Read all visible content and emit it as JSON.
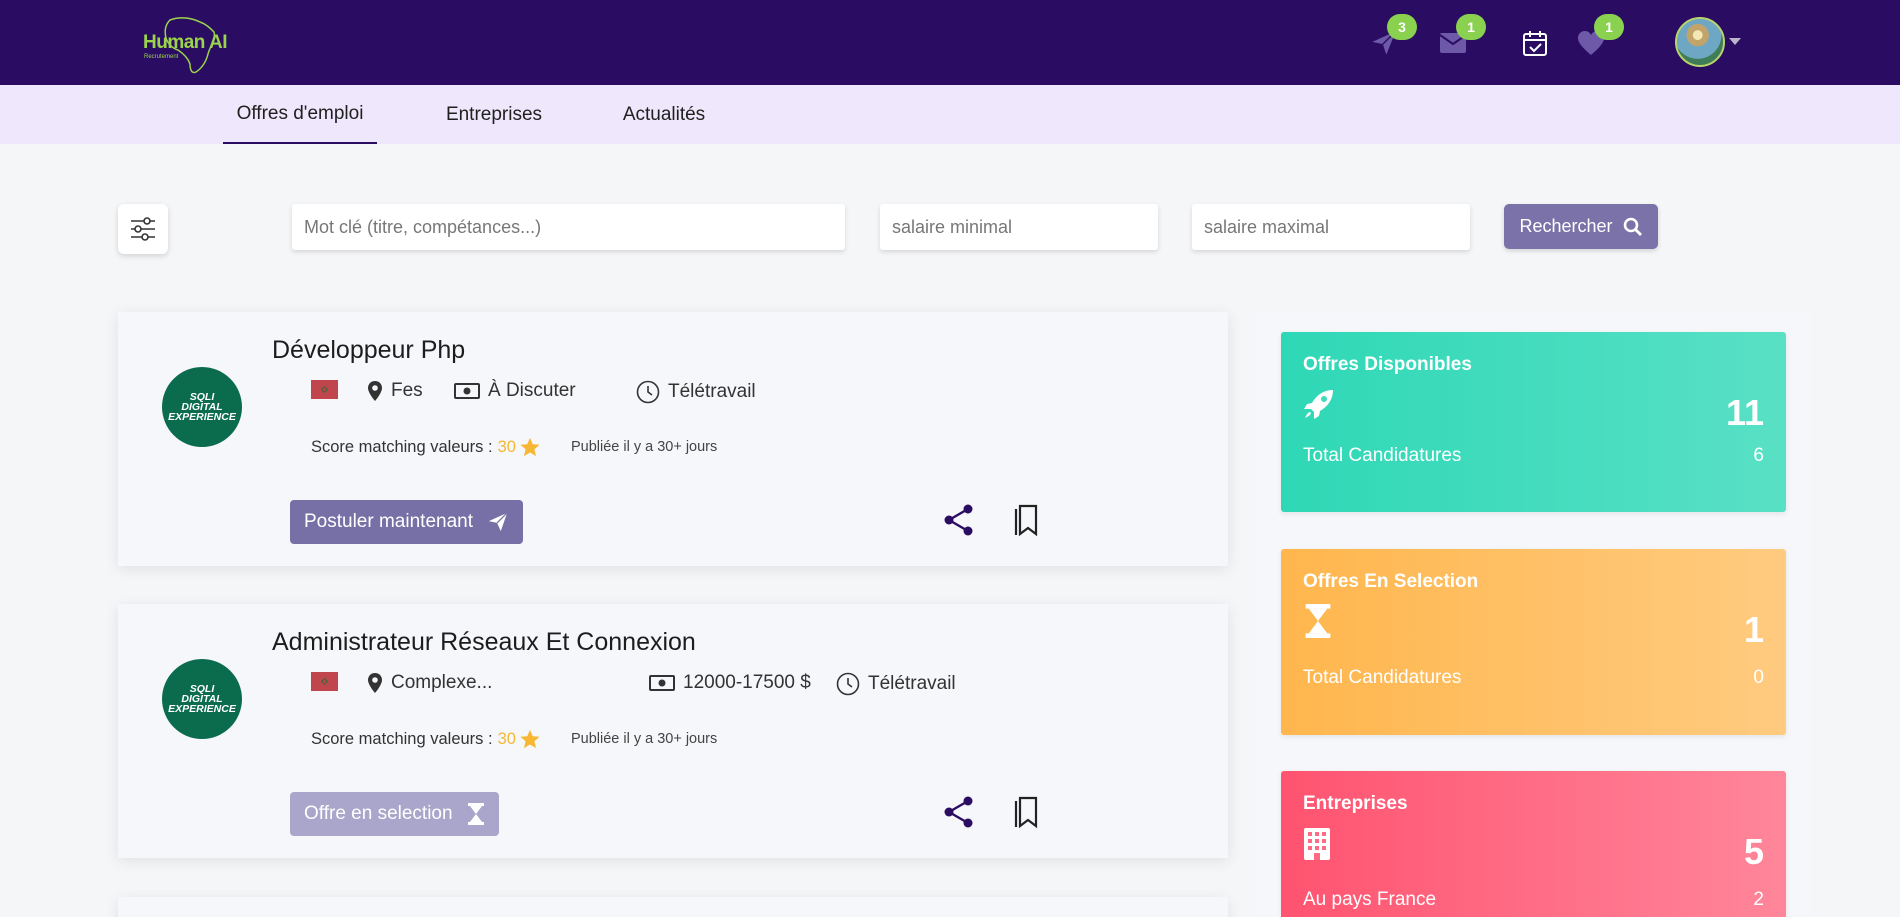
{
  "brand": {
    "name": "Human AI",
    "tagline": "Recrutement"
  },
  "header": {
    "icons": [
      {
        "name": "send-icon",
        "badge": "3"
      },
      {
        "name": "mail-icon",
        "badge": "1"
      },
      {
        "name": "calendar-check-icon",
        "badge": ""
      },
      {
        "name": "heart-icon",
        "badge": "1"
      }
    ]
  },
  "nav": {
    "tabs": [
      {
        "label": "Offres d'emploi",
        "active": true
      },
      {
        "label": "Entreprises",
        "active": false
      },
      {
        "label": "Actualités",
        "active": false
      }
    ]
  },
  "search": {
    "keyword_placeholder": "Mot clé (titre, compétances...)",
    "min_salary_placeholder": "salaire minimal",
    "max_salary_placeholder": "salaire maximal",
    "button_label": "Rechercher"
  },
  "jobs": [
    {
      "company_logo_text": [
        "SQLI",
        "DIGITAL",
        "EXPERIENCE"
      ],
      "title": "Développeur Php",
      "location": "Fes",
      "salary": "À Discuter",
      "work_mode": "Télétravail",
      "score_label": "Score matching valeurs :",
      "score_value": "30",
      "published": "Publiée il y a 30+ jours",
      "action_label": "Postuler maintenant",
      "action_state": "apply"
    },
    {
      "company_logo_text": [
        "SQLI",
        "DIGITAL",
        "EXPERIENCE"
      ],
      "title": "Administrateur Réseaux Et Connexion",
      "location": "Complexe...",
      "salary": "12000-17500 $",
      "work_mode": "Télétravail",
      "score_label": "Score matching valeurs :",
      "score_value": "30",
      "published": "Publiée il y a 30+ jours",
      "action_label": "Offre en selection",
      "action_state": "in-selection"
    }
  ],
  "stats": [
    {
      "title": "Offres Disponibles",
      "icon": "rocket-icon",
      "count": "11",
      "sub_label": "Total Candidatures",
      "sub_value": "6",
      "color_from": "#2ed8b6",
      "color_to": "#59e0c5"
    },
    {
      "title": "Offres En Selection",
      "icon": "hourglass-icon",
      "count": "1",
      "sub_label": "Total Candidatures",
      "sub_value": "0",
      "color_from": "#ffb64d",
      "color_to": "#ffcb80"
    },
    {
      "title": "Entreprises",
      "icon": "building-icon",
      "count": "5",
      "sub_label": "Au pays France",
      "sub_value": "2",
      "color_from": "#ff5370",
      "color_to": "#ff869a"
    }
  ]
}
